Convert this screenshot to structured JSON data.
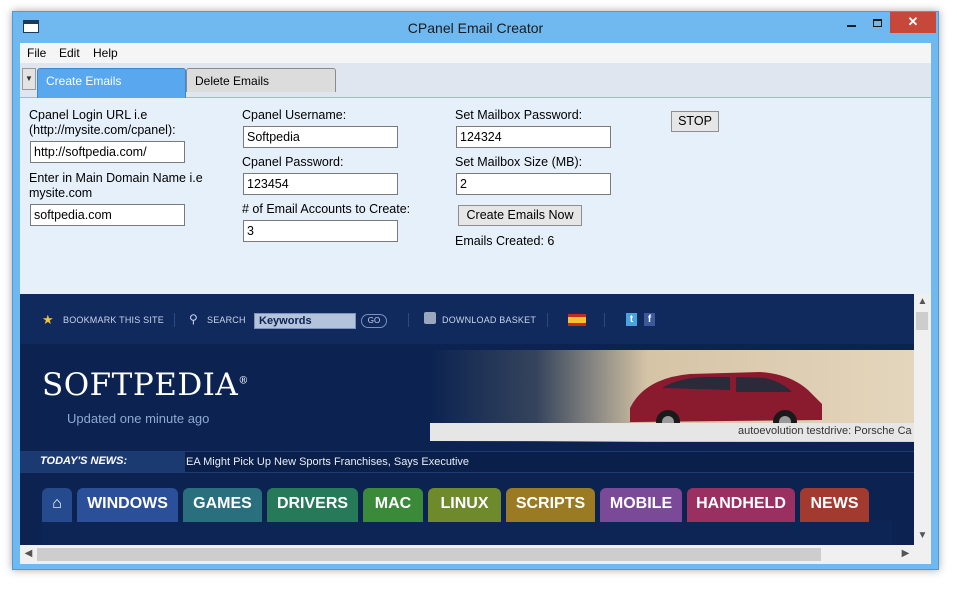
{
  "window": {
    "title": "CPanel Email Creator"
  },
  "menu": [
    "File",
    "Edit",
    "Help"
  ],
  "tabs": [
    {
      "label": "Create Emails",
      "active": true
    },
    {
      "label": "Delete Emails",
      "active": false
    }
  ],
  "form": {
    "login_url_label": "Cpanel Login URL i.e",
    "login_url_label2": "(http://mysite.com/cpanel):",
    "login_url_value": "http://softpedia.com/",
    "domain_label": "Enter in Main Domain Name i.e",
    "domain_label2": "mysite.com",
    "domain_value": "softpedia.com",
    "username_label": "Cpanel Username:",
    "username_value": "Softpedia",
    "password_label": "Cpanel Password:",
    "password_value": "123454",
    "accounts_label": "# of Email Accounts to Create:",
    "accounts_value": "3",
    "mailbox_pw_label": "Set Mailbox Password:",
    "mailbox_pw_value": "124324",
    "mailbox_size_label": "Set Mailbox Size (MB):",
    "mailbox_size_value": "2",
    "create_button": "Create Emails Now",
    "created_label": "Emails Created: 6",
    "stop_button": "STOP"
  },
  "browser": {
    "bookmark": "BOOKMARK THIS SITE",
    "search": "SEARCH",
    "keywords": "Keywords",
    "go": "GO",
    "download_basket": "DOWNLOAD BASKET",
    "logo": "SOFTPEDIA",
    "updated": "Updated one minute ago",
    "banner_caption": "autoevolution testdrive: Porsche Ca",
    "todays_news": "TODAY'S NEWS:",
    "headline": "EA Might Pick Up New Sports Franchises, Says Executive",
    "nav": [
      {
        "label": "WINDOWS",
        "color": "#2c4f9a"
      },
      {
        "label": "GAMES",
        "color": "#2a6f7d"
      },
      {
        "label": "DRIVERS",
        "color": "#267a5a"
      },
      {
        "label": "MAC",
        "color": "#3a8a3a"
      },
      {
        "label": "LINUX",
        "color": "#6e8a2a"
      },
      {
        "label": "SCRIPTS",
        "color": "#9a7a22"
      },
      {
        "label": "MOBILE",
        "color": "#7a4a98"
      },
      {
        "label": "HANDHELD",
        "color": "#9a2f62"
      },
      {
        "label": "NEWS",
        "color": "#a33a2f"
      }
    ]
  },
  "colors": {
    "accent": "#58a7ef",
    "titlebar": "#6fb8f0",
    "close": "#c7483b"
  }
}
